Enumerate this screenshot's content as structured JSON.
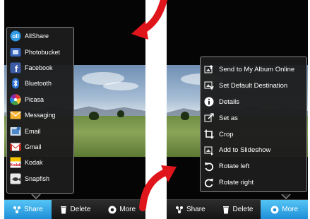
{
  "left_panel": {
    "share_menu": {
      "items": [
        {
          "label": "AllShare",
          "icon": "allshare-icon"
        },
        {
          "label": "Photobucket",
          "icon": "photobucket-icon"
        },
        {
          "label": "Facebook",
          "icon": "facebook-icon"
        },
        {
          "label": "Bluetooth",
          "icon": "bluetooth-icon"
        },
        {
          "label": "Picasa",
          "icon": "picasa-icon"
        },
        {
          "label": "Messaging",
          "icon": "messaging-icon"
        },
        {
          "label": "Email",
          "icon": "email-icon"
        },
        {
          "label": "Gmail",
          "icon": "gmail-icon"
        },
        {
          "label": "Kodak",
          "icon": "kodak-icon"
        },
        {
          "label": "Snapfish",
          "icon": "snapfish-icon"
        }
      ]
    },
    "bottom_bar": {
      "share_label": "Share",
      "delete_label": "Delete",
      "more_label": "More",
      "active": "share"
    }
  },
  "right_panel": {
    "more_menu": {
      "items": [
        {
          "label": "Send to My Album Online",
          "icon": "album-upload-icon"
        },
        {
          "label": "Set Default Destination",
          "icon": "destination-icon"
        },
        {
          "label": "Details",
          "icon": "info-icon"
        },
        {
          "label": "Set as",
          "icon": "set-as-icon"
        },
        {
          "label": "Crop",
          "icon": "crop-icon"
        },
        {
          "label": "Add to Slideshow",
          "icon": "slideshow-icon"
        },
        {
          "label": "Rotate left",
          "icon": "rotate-left-icon"
        },
        {
          "label": "Rotate right",
          "icon": "rotate-right-icon"
        }
      ]
    },
    "bottom_bar": {
      "share_label": "Share",
      "delete_label": "Delete",
      "more_label": "More",
      "active": "more"
    }
  },
  "colors": {
    "callout_arrow": "#e0151b",
    "active_tab": "#2a9be0",
    "menu_border": "#8a8a8a"
  }
}
